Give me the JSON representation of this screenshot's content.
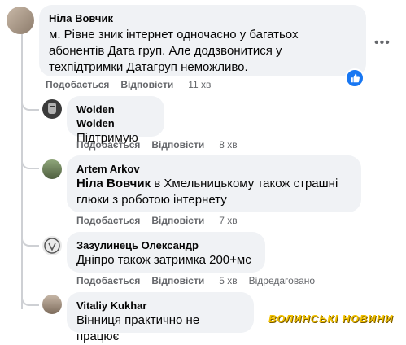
{
  "comments": [
    {
      "author": "Ніла Вовчик",
      "text": "м. Рівне зник інтернет одночасно у багатьох абонентів Дата груп. Але додзвонитися у техпідтримки Датагруп неможливо.",
      "like": "Подобається",
      "reply": "Відповісти",
      "time": "11 хв"
    },
    {
      "author": "Wolden Wolden",
      "text": "Підтримую",
      "like": "Подобається",
      "reply": "Відповісти",
      "time": "8 хв"
    },
    {
      "author": "Artem Arkov",
      "mention": "Ніла Вовчик",
      "text_line1": " в Хмельницькому також страшні",
      "text_line2": "глюки з роботою інтернету",
      "like": "Подобається",
      "reply": "Відповісти",
      "time": "7 хв"
    },
    {
      "author": "Зазулинець Олександр",
      "text": "Дніпро також затримка 200+мс",
      "like": "Подобається",
      "reply": "Відповісти",
      "time": "5 хв",
      "edited": "Відредаговано"
    },
    {
      "author": "Vitaliy Kukhar",
      "text": "Вінниця практично не працює"
    }
  ],
  "watermark": "ВОЛИНСЬКІ НОВИНИ",
  "colors": {
    "bubble": "#f0f2f5",
    "secondary_text": "#65676b",
    "like_badge": "#1877f2"
  }
}
